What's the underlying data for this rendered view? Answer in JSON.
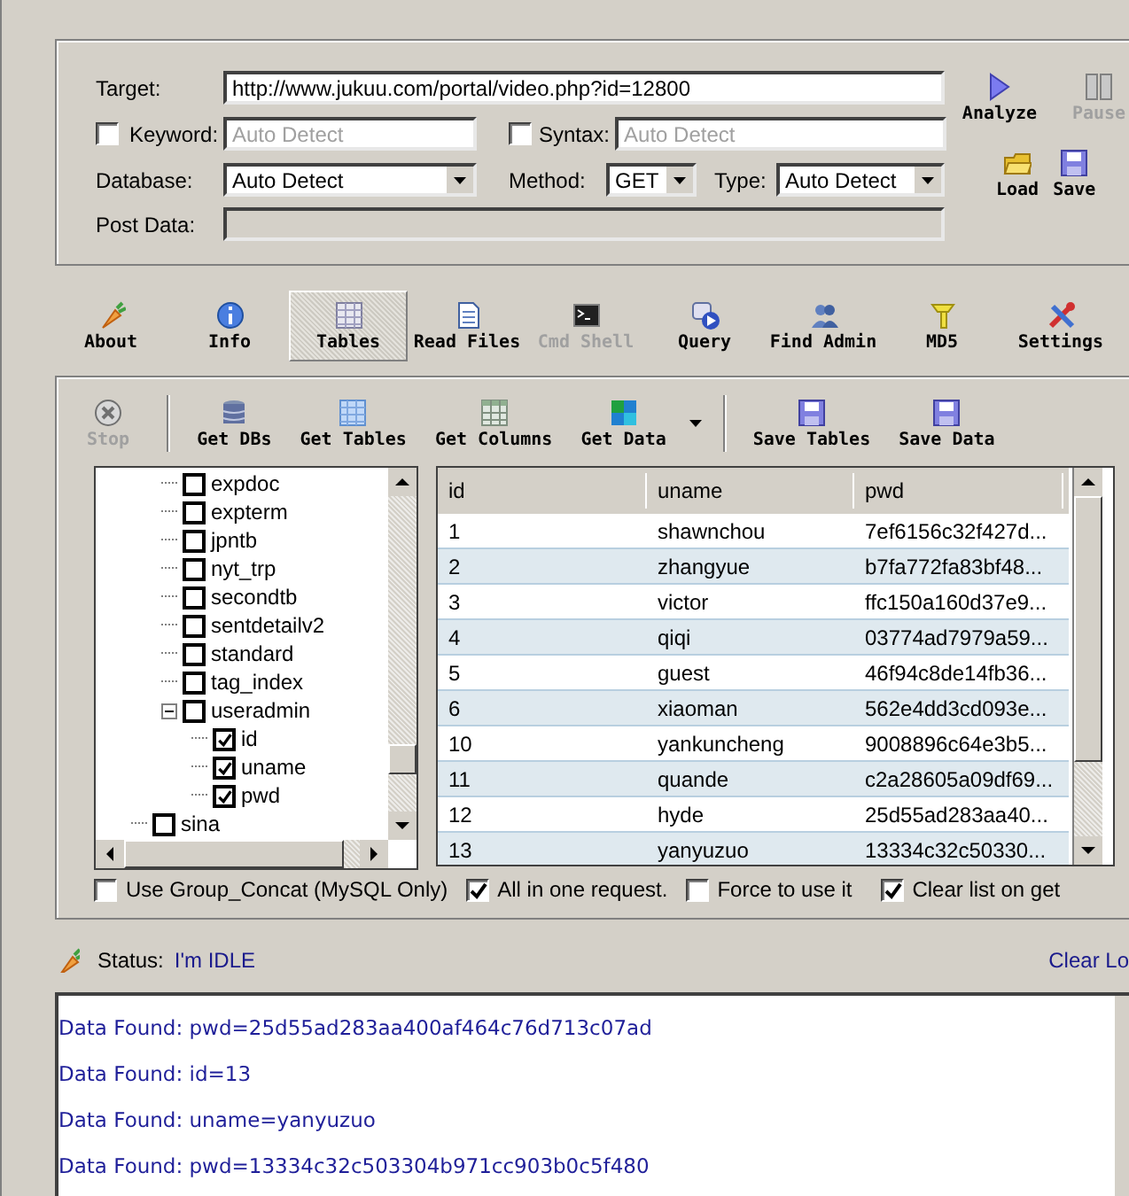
{
  "form": {
    "target": {
      "label": "Target:",
      "value": "http://www.jukuu.com/portal/video.php?id=12800"
    },
    "keyword": {
      "label": "Keyword:",
      "checked": false,
      "placeholder": "Auto Detect"
    },
    "syntax": {
      "label": "Syntax:",
      "checked": false,
      "placeholder": "Auto Detect"
    },
    "database": {
      "label": "Database:",
      "value": "Auto Detect"
    },
    "method": {
      "label": "Method:",
      "value": "GET"
    },
    "type": {
      "label": "Type:",
      "value": "Auto Detect"
    },
    "post_data": {
      "label": "Post Data:",
      "disabled": true
    }
  },
  "actions": [
    {
      "label": "Analyze",
      "disabled": false
    },
    {
      "label": "Pause",
      "disabled": true
    },
    {
      "label": "Load",
      "disabled": false
    },
    {
      "label": "Save",
      "disabled": false
    }
  ],
  "tabs": [
    {
      "label": "About",
      "selected": false,
      "disabled": false
    },
    {
      "label": "Info",
      "selected": false,
      "disabled": false
    },
    {
      "label": "Tables",
      "selected": true,
      "disabled": false
    },
    {
      "label": "Read Files",
      "selected": false,
      "disabled": false
    },
    {
      "label": "Cmd Shell",
      "selected": false,
      "disabled": true
    },
    {
      "label": "Query",
      "selected": false,
      "disabled": false
    },
    {
      "label": "Find Admin",
      "selected": false,
      "disabled": false
    },
    {
      "label": "MD5",
      "selected": false,
      "disabled": false
    },
    {
      "label": "Settings",
      "selected": false,
      "disabled": false
    }
  ],
  "toolbar": [
    {
      "kind": "button",
      "label": "Stop",
      "disabled": true
    },
    {
      "kind": "separator"
    },
    {
      "kind": "button",
      "label": "Get DBs",
      "disabled": false
    },
    {
      "kind": "button",
      "label": "Get Tables",
      "disabled": false
    },
    {
      "kind": "button",
      "label": "Get Columns",
      "disabled": false
    },
    {
      "kind": "button",
      "label": "Get Data",
      "disabled": false,
      "dropdown": true
    },
    {
      "kind": "separator"
    },
    {
      "kind": "button",
      "label": "Save Tables",
      "disabled": false
    },
    {
      "kind": "button",
      "label": "Save Data",
      "disabled": false
    }
  ],
  "tree": {
    "items": [
      {
        "children": [
          {
            "label": "expdoc",
            "checked": false
          },
          {
            "label": "expterm",
            "checked": false
          },
          {
            "label": "jpntb",
            "checked": false
          },
          {
            "label": "nyt_trp",
            "checked": false
          },
          {
            "label": "secondtb",
            "checked": false
          },
          {
            "label": "sentdetailv2",
            "checked": false
          },
          {
            "label": "standard",
            "checked": false
          },
          {
            "label": "tag_index",
            "checked": false
          },
          {
            "label": "useradmin",
            "checked": false,
            "expanded": true,
            "children": [
              {
                "label": "id",
                "checked": true
              },
              {
                "label": "uname",
                "checked": true
              },
              {
                "label": "pwd",
                "checked": true
              }
            ]
          }
        ]
      },
      {
        "label": "sina",
        "checked": false
      }
    ]
  },
  "table": {
    "columns": [
      "id",
      "uname",
      "pwd"
    ],
    "rows": [
      [
        "1",
        "shawnchou",
        "7ef6156c32f427d..."
      ],
      [
        "2",
        "zhangyue",
        "b7fa772fa83bf48..."
      ],
      [
        "3",
        "victor",
        "ffc150a160d37e9..."
      ],
      [
        "4",
        "qiqi",
        "03774ad7979a59..."
      ],
      [
        "5",
        "guest",
        "46f94c8de14fb36..."
      ],
      [
        "6",
        "xiaoman",
        "562e4dd3cd093e..."
      ],
      [
        "10",
        "yankuncheng",
        "9008896c64e3b5..."
      ],
      [
        "11",
        "quande",
        "c2a28605a09df69..."
      ],
      [
        "12",
        "hyde",
        "25d55ad283aa40..."
      ],
      [
        "13",
        "yanyuzuo",
        "13334c32c50330..."
      ]
    ]
  },
  "options": [
    {
      "label": "Use Group_Concat (MySQL Only)",
      "checked": false
    },
    {
      "label": "All in one request.",
      "checked": true
    },
    {
      "label": "Force to use it",
      "checked": false
    },
    {
      "label": "Clear list on get",
      "checked": true
    }
  ],
  "status": {
    "label": "Status:",
    "value": "I'm IDLE",
    "link": "Clear Lo"
  },
  "log": [
    "Data Found: pwd=25d55ad283aa400af464c76d713c07ad",
    "Data Found: id=13",
    "Data Found: uname=yanyuzuo",
    "Data Found: pwd=13334c32c503304b971cc903b0c5f480"
  ]
}
